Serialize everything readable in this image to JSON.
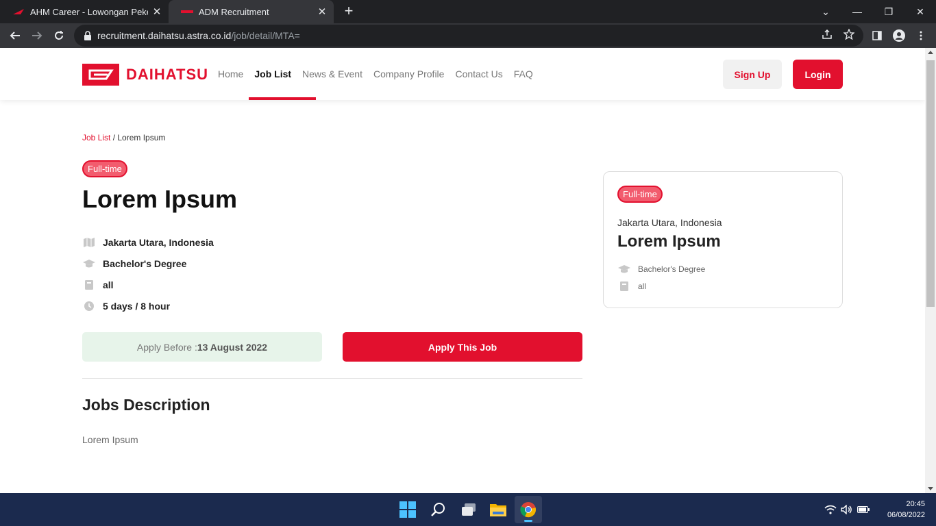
{
  "browser": {
    "tabs": [
      {
        "title": "AHM Career - Lowongan Pekerjaan",
        "active": false
      },
      {
        "title": "ADM Recruitment",
        "active": true
      }
    ],
    "url_host": "recruitment.daihatsu.astra.co.id",
    "url_path": "/job/detail/MTA="
  },
  "site": {
    "logo_text": "DAIHATSU",
    "nav": [
      "Home",
      "Job List",
      "News & Event",
      "Company Profile",
      "Contact Us",
      "FAQ"
    ],
    "active_nav": "Job List",
    "signup_label": "Sign Up",
    "login_label": "Login",
    "accent_color": "#e2102e"
  },
  "breadcrumb": {
    "parent": "Job List",
    "separator": " / ",
    "current": "Lorem Ipsum"
  },
  "job": {
    "type": "Full-time",
    "title": "Lorem Ipsum",
    "location": "Jakarta Utara, Indonesia",
    "education": "Bachelor's Degree",
    "major": "all",
    "schedule": "5 days / 8 hour",
    "apply_before_label": "Apply Before :",
    "apply_before_date": "13 August 2022",
    "apply_button": "Apply This Job",
    "description_heading": "Jobs Description",
    "description": "Lorem Ipsum"
  },
  "sidebar_card": {
    "type": "Full-time",
    "location": "Jakarta Utara, Indonesia",
    "title": "Lorem Ipsum",
    "education": "Bachelor's Degree",
    "major": "all"
  },
  "taskbar": {
    "time": "20:45",
    "date": "06/08/2022"
  }
}
